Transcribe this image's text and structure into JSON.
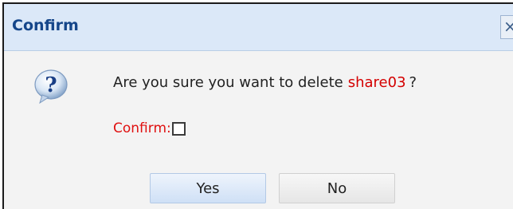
{
  "dialog": {
    "title": "Confirm",
    "close_glyph": "×",
    "icon": "question-icon",
    "message": {
      "prefix": "Are you sure you want to delete",
      "item_name": "share03",
      "suffix": "?"
    },
    "confirm_label": "Confirm:",
    "confirm_checked": false,
    "buttons": {
      "yes": "Yes",
      "no": "No"
    }
  },
  "colors": {
    "title": "#15468a",
    "titlebar_bg": "#dbe8f8",
    "highlight_red": "#d40000",
    "yes_button_bg": "#cfe0f6"
  }
}
